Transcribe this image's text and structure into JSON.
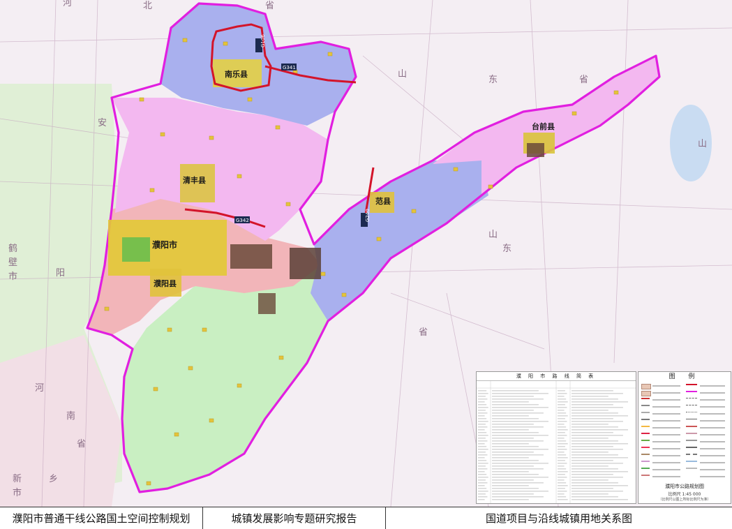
{
  "banner": {
    "left": "濮阳市普通干线公路国土空间控制规划",
    "middle": "城镇发展影响专题研究报告",
    "right": "国道项目与沿线城镇用地关系图"
  },
  "colors": {
    "region_north": "#a9b1ee",
    "region_upper": "#f3b7f0",
    "region_center": "#f2b3b6",
    "region_south": "#c8eec1",
    "region_east": "#a9b1ee",
    "region_east_pink": "#f3b7f0",
    "boundary": "#e11fe0",
    "national_road": "#d3142a",
    "outside_left": "#d9ead2",
    "lake": "#c9dcf2"
  },
  "region_labels": {
    "north": "河",
    "north2": "北",
    "north3": "省",
    "shandong1": "山",
    "shandong2": "东",
    "shandong3": "省",
    "henan1": "河",
    "henan2": "南",
    "henan3": "省",
    "anyang": "安",
    "anyang2": "阳",
    "hebi": "鹤",
    "hebi2": "壁",
    "hebi3": "市",
    "xinxiang": "新",
    "xinxiang2": "乡",
    "xinxiang3": "市",
    "east_shan": "山",
    "east_dong": "东",
    "east_sheng": "省",
    "east_shan2": "山"
  },
  "cities": {
    "nanle": "南乐县",
    "qingfeng": "清丰县",
    "puyang_city": "濮阳市",
    "puyang_county": "濮阳县",
    "fan": "范县",
    "taiqian": "台前县"
  },
  "road_labels": {
    "g341_n": "G341",
    "g106": "G106",
    "g342": "G342",
    "g240": "G240"
  },
  "road_table": {
    "title": "濮 阳 市 路 线 简 表"
  },
  "legend": {
    "title": "图 例",
    "map_title": "濮阳市公路规划图",
    "scale": "比例尺  1:45 000",
    "note": "（比例尺以图上所标比例尺为准）"
  }
}
